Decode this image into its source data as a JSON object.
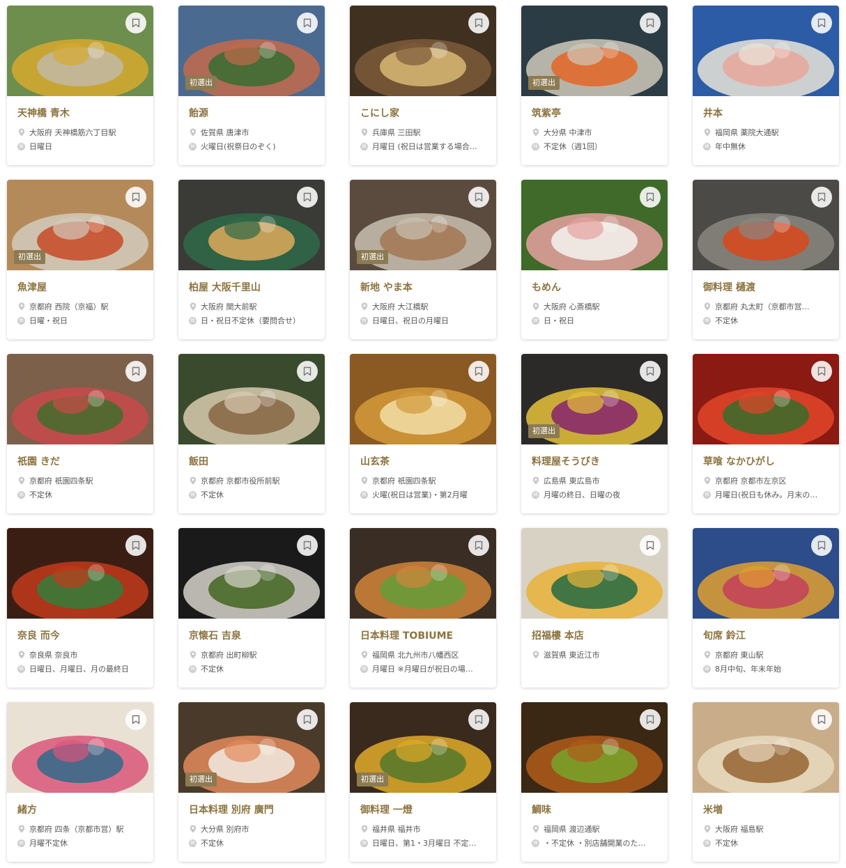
{
  "badge_label": "初選出",
  "holiday_icon_char": "休",
  "colors": {
    "accent": "#8c7440",
    "badge_bg": "#8c7a52",
    "text": "#555555"
  },
  "icons": {
    "location": "pin-icon",
    "holiday": "holiday-icon",
    "save": "bookmark-icon"
  },
  "restaurants": [
    {
      "name": "天神橋 青木",
      "location": "大阪府 天神橋筋六丁目駅",
      "holiday": "日曜日",
      "new": false,
      "photo_colors": [
        "#6d8e4d",
        "#d7a92f",
        "#c2b8a0"
      ]
    },
    {
      "name": "飴源",
      "location": "佐賀県 唐津市",
      "holiday": "火曜日(祝祭日のぞく)",
      "new": true,
      "photo_colors": [
        "#4a6a90",
        "#c26a4b",
        "#3f6d34"
      ]
    },
    {
      "name": "こにし家",
      "location": "兵庫県 三田駅",
      "holiday": "月曜日 (祝日は営業する場合…",
      "new": false,
      "photo_colors": [
        "#3f3020",
        "#7d5a3a",
        "#d3b471"
      ]
    },
    {
      "name": "筑紫亭",
      "location": "大分県 中津市",
      "holiday": "不定休（週1回）",
      "new": true,
      "photo_colors": [
        "#2c3c44",
        "#cfc9bb",
        "#e0692d"
      ]
    },
    {
      "name": "井本",
      "location": "福岡県 薬院大通駅",
      "holiday": "年中無休",
      "new": false,
      "photo_colors": [
        "#2c5ca6",
        "#e9e4d8",
        "#e7a89d"
      ]
    },
    {
      "name": "魚津屋",
      "location": "京都府 西院（京福）駅",
      "holiday": "日曜・祝日",
      "new": true,
      "photo_colors": [
        "#b58a5a",
        "#d2cabc",
        "#c8502c"
      ]
    },
    {
      "name": "柏屋 大阪千里山",
      "location": "大阪府 関大前駅",
      "holiday": "日・祝日不定休（要問合せ）",
      "new": false,
      "photo_colors": [
        "#3a3a36",
        "#2f6a48",
        "#d4a65a"
      ]
    },
    {
      "name": "新地 やま本",
      "location": "大阪府 大江橋駅",
      "holiday": "日曜日、祝日の月曜日",
      "new": true,
      "photo_colors": [
        "#5b4b3f",
        "#c9c0b0",
        "#a47a58"
      ]
    },
    {
      "name": "もめん",
      "location": "大阪府 心斎橋駅",
      "holiday": "日・祝日",
      "new": false,
      "photo_colors": [
        "#3f6a2a",
        "#e6a1a0",
        "#f2eee9"
      ]
    },
    {
      "name": "御料理 樋渡",
      "location": "京都府 丸太町（京都市営…",
      "holiday": "不定休",
      "new": false,
      "photo_colors": [
        "#4c4a46",
        "#8a8680",
        "#d44a1f"
      ]
    },
    {
      "name": "祇園 きだ",
      "location": "京都府 祇園四条駅",
      "holiday": "不定休",
      "new": false,
      "photo_colors": [
        "#7c6049",
        "#c94a4a",
        "#4a6b2f"
      ]
    },
    {
      "name": "飯田",
      "location": "京都府 京都市役所前駅",
      "holiday": "不定休",
      "new": false,
      "photo_colors": [
        "#3a4a2d",
        "#d9cbb0",
        "#8a6a48"
      ]
    },
    {
      "name": "山玄茶",
      "location": "京都府 祇園四条駅",
      "holiday": "火曜(祝日は営業)・第2月曜",
      "new": false,
      "photo_colors": [
        "#8a5a22",
        "#d39a3a",
        "#f0d9a0"
      ]
    },
    {
      "name": "料理屋そうびき",
      "location": "広島県 東広島市",
      "holiday": "月曜の終日、日曜の夜",
      "new": true,
      "photo_colors": [
        "#2c2a28",
        "#e6c23a",
        "#8a2a6a"
      ]
    },
    {
      "name": "草喰 なかひがし",
      "location": "京都府 京都市左京区",
      "holiday": "月曜日(祝日も休み。月末の…",
      "new": false,
      "photo_colors": [
        "#8a1a12",
        "#e0462a",
        "#3f6a2a"
      ]
    },
    {
      "name": "奈良 而今",
      "location": "奈良県 奈良市",
      "holiday": "日曜日、月曜日、月の最終日",
      "new": false,
      "photo_colors": [
        "#3a1e14",
        "#c23a1a",
        "#3a7a3a"
      ]
    },
    {
      "name": "京懐石 吉泉",
      "location": "京都府 出町柳駅",
      "holiday": "不定休",
      "new": false,
      "photo_colors": [
        "#1a1a1a",
        "#d7d4cc",
        "#4a6a2a"
      ]
    },
    {
      "name": "日本料理 TOBIUME",
      "location": "福岡県 北九州市八幡西区",
      "holiday": "月曜日 ※月曜日が祝日の場…",
      "new": false,
      "photo_colors": [
        "#3a2e24",
        "#d2843a",
        "#6a9a3a"
      ]
    },
    {
      "name": "招福樓 本店",
      "location": "滋賀県 東近江市",
      "holiday": "",
      "new": false,
      "photo_colors": [
        "#d8d2c4",
        "#e8b33a",
        "#2f6e42"
      ]
    },
    {
      "name": "旬席 鈴江",
      "location": "京都府 東山駅",
      "holiday": "8月中旬、年末年始",
      "new": false,
      "photo_colors": [
        "#2c4c8a",
        "#e0a030",
        "#c2455a"
      ]
    },
    {
      "name": "緒方",
      "location": "京都府 四条（京都市営）駅",
      "holiday": "月曜不定休",
      "new": false,
      "photo_colors": [
        "#e8e1d4",
        "#d9567a",
        "#3a6a8a"
      ]
    },
    {
      "name": "日本料理 別府 廣門",
      "location": "大分県 別府市",
      "holiday": "不定休",
      "new": true,
      "photo_colors": [
        "#4a3a2a",
        "#e28a5a",
        "#f0e6da"
      ]
    },
    {
      "name": "御料理 一燈",
      "location": "福井県 福井市",
      "holiday": "日曜日、第1・3月曜日 不定…",
      "new": true,
      "photo_colors": [
        "#3a2a1e",
        "#e0aa2a",
        "#5a7a2a"
      ]
    },
    {
      "name": "鯛味",
      "location": "福岡県 渡辺通駅",
      "holiday": "・不定休 ・別店舗開業のた…",
      "new": false,
      "photo_colors": [
        "#3a2814",
        "#b05a1a",
        "#7aa02a"
      ]
    },
    {
      "name": "米増",
      "location": "大阪府 福島駅",
      "holiday": "不定休",
      "new": false,
      "photo_colors": [
        "#c8ad88",
        "#e8d9c0",
        "#9a6a3a"
      ]
    }
  ]
}
